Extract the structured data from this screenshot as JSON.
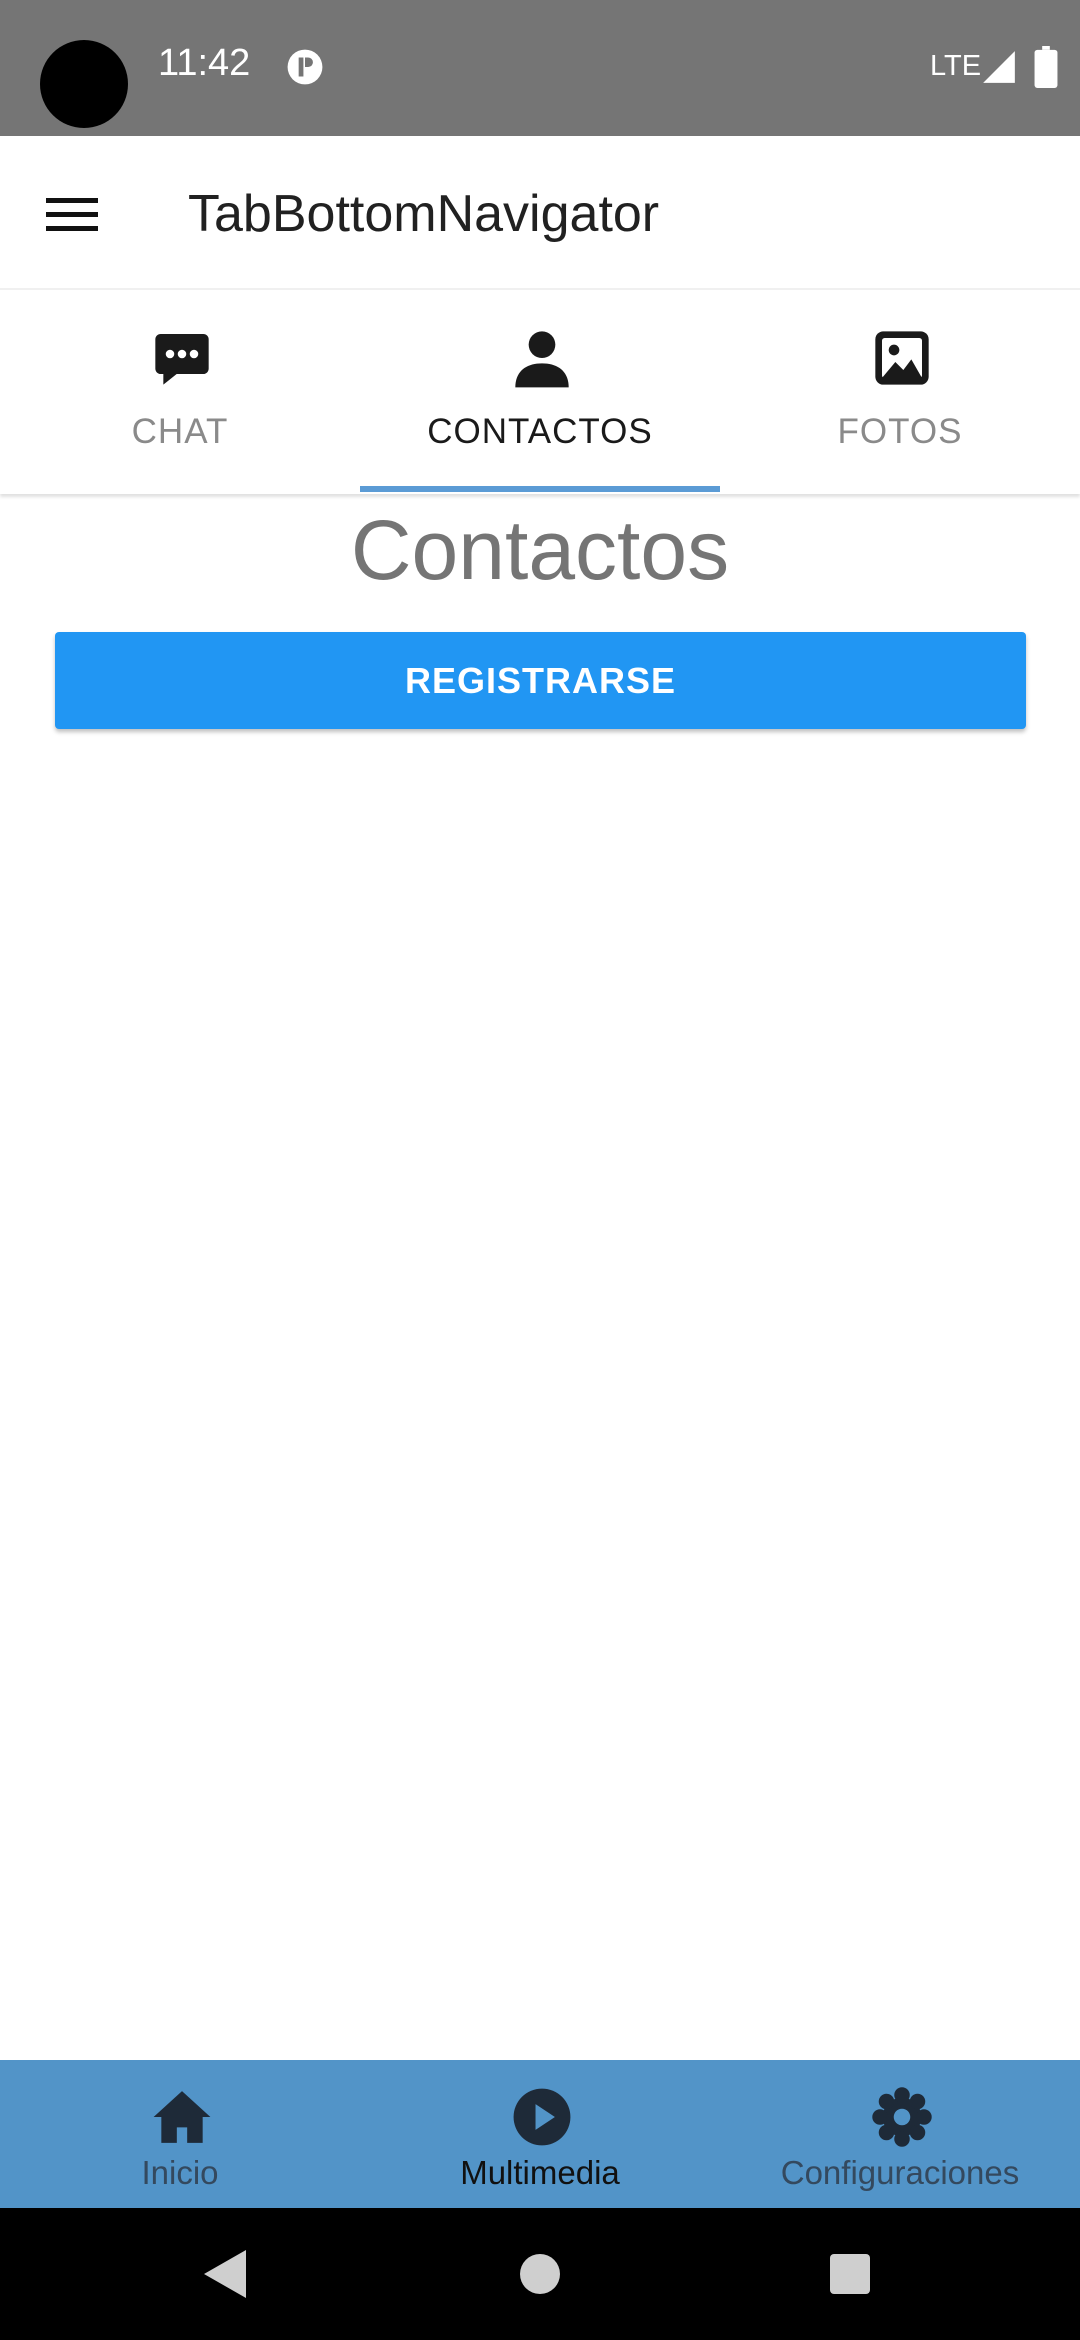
{
  "status_bar": {
    "time": "11:42",
    "network": "LTE",
    "icons": [
      "camera-cutout",
      "app-notification-icon",
      "signal-icon",
      "battery-icon"
    ]
  },
  "app_bar": {
    "title": "TabBottomNavigator",
    "menu_icon": "menu-icon"
  },
  "top_tabs": [
    {
      "label": "CHAT",
      "icon": "chat-icon",
      "active": false
    },
    {
      "label": "CONTACTOS",
      "icon": "person-icon",
      "active": true
    },
    {
      "label": "FOTOS",
      "icon": "image-icon",
      "active": false
    }
  ],
  "content": {
    "title": "Contactos",
    "button_label": "REGISTRARSE"
  },
  "bottom_nav": [
    {
      "label": "Inicio",
      "icon": "home-icon",
      "active": false
    },
    {
      "label": "Multimedia",
      "icon": "play-icon",
      "active": true
    },
    {
      "label": "Configuraciones",
      "icon": "settings-icon",
      "active": false
    }
  ],
  "colors": {
    "status_bar": "#757575",
    "accent": "#2196f3",
    "tab_indicator": "#5b9bd5",
    "bottom_nav": "#5294c8"
  }
}
